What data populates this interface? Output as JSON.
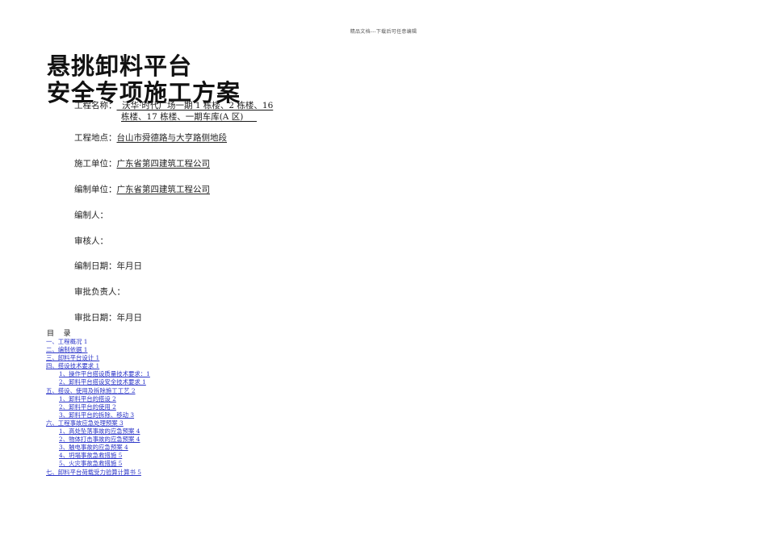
{
  "header_note": "精品文档---下载后可任意编辑",
  "title": {
    "line1": "悬挑卸料平台",
    "line2": "安全专项施工方案"
  },
  "project": {
    "name_label": "工程名称：",
    "name_value_line1": "  沃华·时代广场一期 1 栋楼、2 栋楼、16",
    "name_value_line2": "栋楼、17 栋楼、一期车库(A 区)     ",
    "location_label": "工程地点：",
    "location_value": "台山市舜德路与大亨路侧地段",
    "contractor_label": "施工单位：",
    "contractor_value": "广东省第四建筑工程公司",
    "compiler_unit_label": "编制单位：",
    "compiler_unit_value": "广东省第四建筑工程公司",
    "compiler_label": "编制人：",
    "reviewer_label": "审核人：",
    "compile_date_label": "编制日期：年月日",
    "approver_label": "审批负责人：",
    "approve_date_label": "审批日期：年月日"
  },
  "toc": {
    "heading": "目    录",
    "items": [
      {
        "text": "一、工程概况 1",
        "level": 1,
        "link": false
      },
      {
        "text": "二、编制依据 1",
        "level": 1,
        "link": true
      },
      {
        "text": "三、卸料平台设计 1",
        "level": 1,
        "link": true
      },
      {
        "text": "四、搭设技术要求 1",
        "level": 1,
        "link": true
      },
      {
        "text": "1、操作平台搭设质量技术要求：1",
        "level": 2,
        "link": true
      },
      {
        "text": "2、卸料平台搭设安全技术要求 1",
        "level": 2,
        "link": true
      },
      {
        "text": "五、搭设、使用及拆除施工工艺 2",
        "level": 1,
        "link": true
      },
      {
        "text": "1、卸料平台的搭设 2",
        "level": 2,
        "link": true
      },
      {
        "text": "2、卸料平台的使用 2",
        "level": 2,
        "link": true
      },
      {
        "text": "3、卸料平台的拆除、移动 3",
        "level": 2,
        "link": true
      },
      {
        "text": "六、工程事故应急处理预案 3",
        "level": 1,
        "link": true
      },
      {
        "text": "1、高处坠落事故的应急预案 4",
        "level": 2,
        "link": true
      },
      {
        "text": "2、物体打击事故的应急预案 4",
        "level": 2,
        "link": true
      },
      {
        "text": "3、触电事故的应急预案 4",
        "level": 2,
        "link": true
      },
      {
        "text": "4、坍塌事故急救措施 5",
        "level": 2,
        "link": true
      },
      {
        "text": "5、火灾事故急救措施 5",
        "level": 2,
        "link": true
      },
      {
        "text": "七、卸料平台荷载受力验算计算书 5",
        "level": 1,
        "link": true
      }
    ]
  },
  "colors": {
    "link": "#2b35c8",
    "text": "#1a1a1a"
  }
}
